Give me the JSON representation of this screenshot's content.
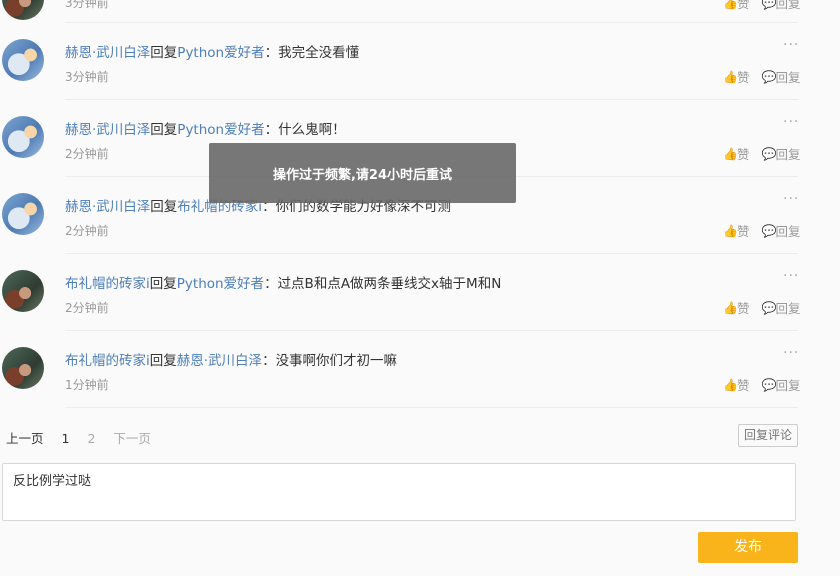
{
  "partial_top": {
    "time": "3分钟前",
    "like_label": "赞",
    "reply_label": "回复"
  },
  "comments": [
    {
      "from": "赫恩·武川白泽",
      "reply_word": "回复",
      "to": "Python爱好者",
      "sep": "：",
      "text": "我完全没看懂",
      "time": "3分钟前",
      "like_label": "赞",
      "reply_label": "回复"
    },
    {
      "from": "赫恩·武川白泽",
      "reply_word": "回复",
      "to": "Python爱好者",
      "sep": "：",
      "text": "什么鬼啊！",
      "time": "2分钟前",
      "like_label": "赞",
      "reply_label": "回复"
    },
    {
      "from": "赫恩·武川白泽",
      "reply_word": "回复",
      "to": "布礼帽的砖家i",
      "sep": "：",
      "text": "你们的数学能力好像深不可测",
      "time": "2分钟前",
      "like_label": "赞",
      "reply_label": "回复"
    },
    {
      "from": "布礼帽的砖家i",
      "reply_word": "回复",
      "to": "Python爱好者",
      "sep": "：",
      "text": "过点B和点A做两条垂线交x轴于M和N",
      "time": "2分钟前",
      "like_label": "赞",
      "reply_label": "回复"
    },
    {
      "from": "布礼帽的砖家i",
      "reply_word": "回复",
      "to": "赫恩·武川白泽",
      "sep": "：",
      "text": "没事啊你们才初一嘛",
      "time": "1分钟前",
      "like_label": "赞",
      "reply_label": "回复"
    }
  ],
  "more_icon": "···",
  "pagination": {
    "prev": "上一页",
    "page1": "1",
    "page2": "2",
    "next": "下一页"
  },
  "reply_comment_button": "回复评论",
  "editor": {
    "text": "反比例学过哒"
  },
  "publish_button": "发布",
  "toast": "操作过于频繁,请24小时后重试",
  "icons": {
    "like": "thumb-up-icon",
    "reply": "comment-bubble-icon"
  },
  "colors": {
    "username": "#4e7fb8",
    "publish": "#f9b41b",
    "toast_bg": "#646464"
  }
}
